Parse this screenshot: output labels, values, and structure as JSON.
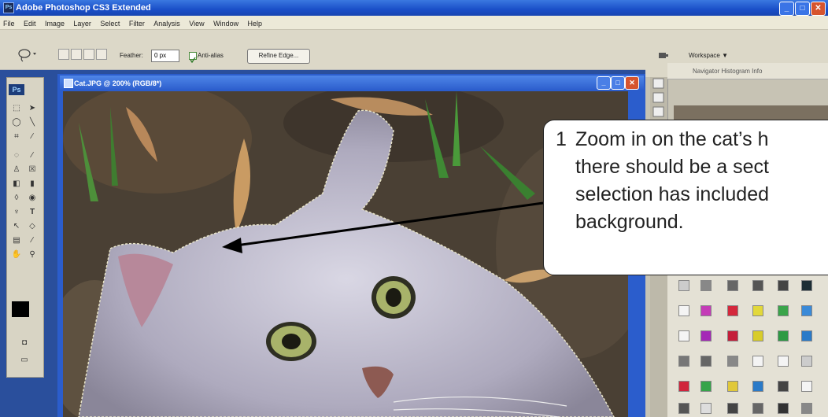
{
  "window": {
    "title": "Adobe Photoshop CS3 Extended",
    "app_badge": "Ps",
    "controls": [
      "_",
      "□",
      "✕"
    ]
  },
  "menubar": [
    "File",
    "Edit",
    "Image",
    "Layer",
    "Select",
    "Filter",
    "Analysis",
    "View",
    "Window",
    "Help"
  ],
  "options": {
    "feather_label": "Feather:",
    "feather_value": "0 px",
    "antialias_label": "Anti-alias",
    "antialias_checked": true,
    "refine_edge_label": "Refine Edge..."
  },
  "workspace": {
    "label": "Workspace ▼"
  },
  "document": {
    "title": "Cat.JPG @ 200% (RGB/8*)"
  },
  "panels": {
    "navigator_tabs": "Navigator  Histogram  Info"
  },
  "callout": {
    "number": "1",
    "lines": [
      "Zoom in on the cat’s h",
      "there should be a sect",
      "selection has included",
      "background."
    ]
  },
  "colors": {
    "xp_title": "#1a4fc8",
    "doc_title": "#2b5dcc",
    "panel_bg": "#dcd8c8",
    "callout_border": "#222222",
    "arrow": "#000000"
  }
}
